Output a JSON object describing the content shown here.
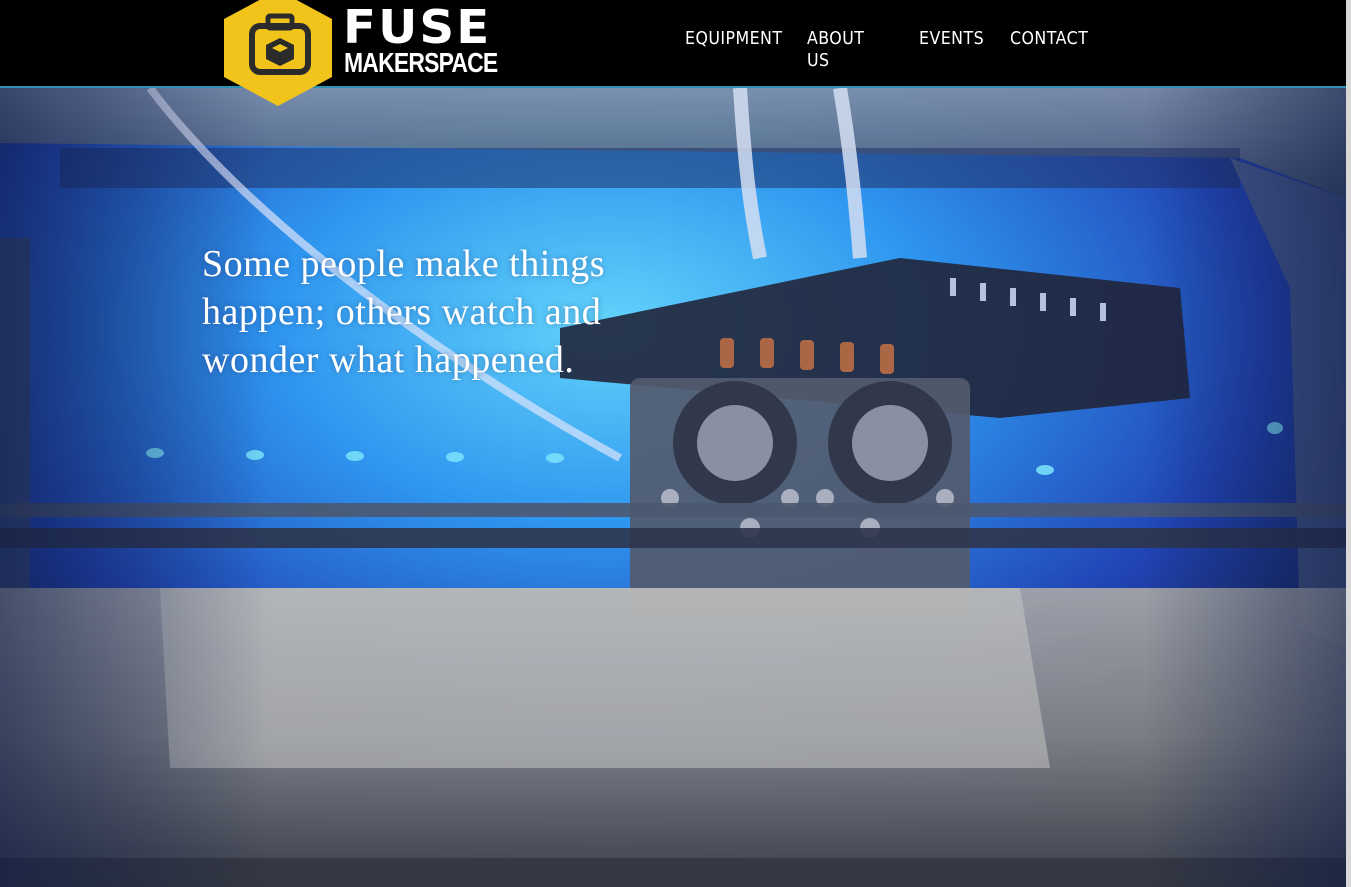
{
  "brand": {
    "name": "FUSE",
    "subtitle": "MAKERSPACE",
    "logo_icon": "box-camera-hexagon-icon",
    "logo_color": "#f2c31b"
  },
  "nav": {
    "items": [
      {
        "label": "EQUIPMENT"
      },
      {
        "label": "ABOUT US"
      },
      {
        "label": "EVENTS"
      },
      {
        "label": "CONTACT"
      }
    ]
  },
  "hero": {
    "quote": "Some people make things happen; others watch and wonder what happened."
  },
  "colors": {
    "header_bg": "#000000",
    "header_border": "#2f8fb0",
    "hero_tint": "#4a6fe0",
    "text": "#ffffff"
  }
}
